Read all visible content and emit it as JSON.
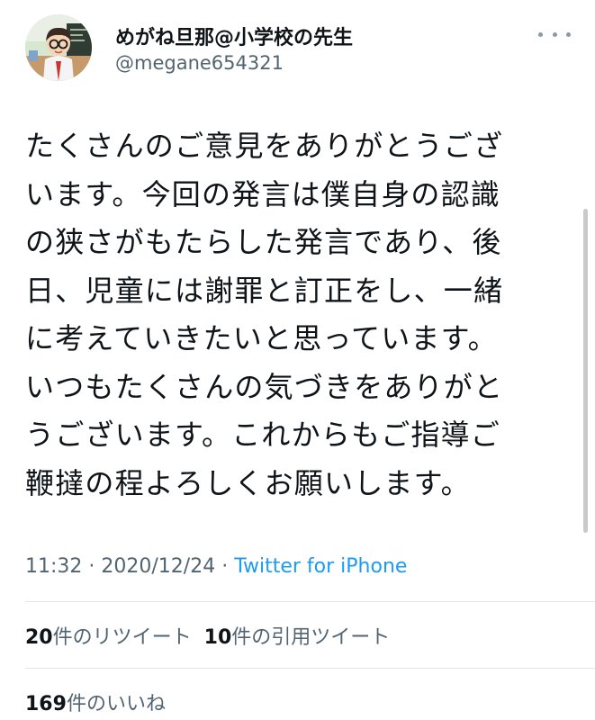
{
  "tweet": {
    "display_name": "めがね旦那@小学校の先生",
    "handle": "@megane654321",
    "text_lines": [
      "たくさんのご意見をありがとうござ",
      "います。今回の発言は僕自身の認識",
      "の狭さがもたらした発言であり、後",
      "日、児童には謝罪と訂正をし、一緒",
      "に考えていきたいと思っています。",
      "いつもたくさんの気づきをありがと",
      "うございます。これからもご指導ご",
      "鞭撻の程よろしくお願いします。"
    ],
    "time": "11:32",
    "separator": " · ",
    "date": "2020/12/24",
    "source": "Twitter for iPhone"
  },
  "stats": {
    "retweets_count": "20",
    "retweets_label": "件のリツイート",
    "quotes_count": "10",
    "quotes_label": "件の引用ツイート",
    "likes_count": "169",
    "likes_label": "件のいいね"
  },
  "icons": {
    "more": "more-horizontal-icon"
  },
  "colors": {
    "text": "#0f1419",
    "secondary": "#536471",
    "link": "#1d9bf0",
    "divider": "#e1e6ea"
  }
}
